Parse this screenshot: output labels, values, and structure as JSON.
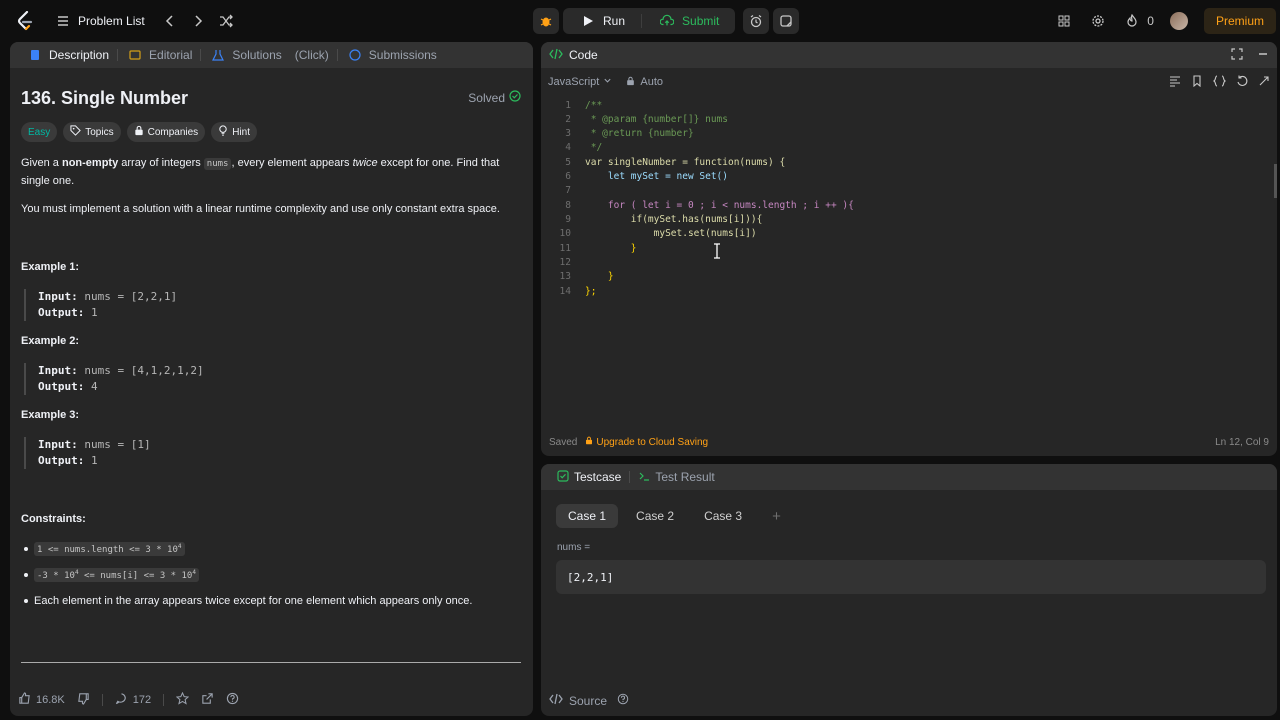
{
  "nav": {
    "problem_list": "Problem List",
    "run": "Run",
    "submit": "Submit",
    "streak": "0",
    "premium": "Premium"
  },
  "left_tabs": {
    "description": "Description",
    "editorial": "Editorial",
    "solutions": "Solutions",
    "click": "(Click)",
    "submissions": "Submissions"
  },
  "problem": {
    "title": "136. Single Number",
    "solved": "Solved",
    "tags": {
      "difficulty": "Easy",
      "topics": "Topics",
      "companies": "Companies",
      "hint": "Hint"
    },
    "para1_a": "Given a ",
    "para1_b": "non-empty",
    "para1_c": " array of integers ",
    "para1_code": "nums",
    "para1_d": ", every element appears ",
    "para1_e": "twice",
    "para1_f": " except for one. Find that single one.",
    "para2": "You must implement a solution with a linear runtime complexity and use only constant extra space.",
    "examples": [
      {
        "title": "Example 1:",
        "input_label": "Input:",
        "input": "nums = [2,2,1]",
        "output_label": "Output:",
        "output": "1"
      },
      {
        "title": "Example 2:",
        "input_label": "Input:",
        "input": "nums = [4,1,2,1,2]",
        "output_label": "Output:",
        "output": "4"
      },
      {
        "title": "Example 3:",
        "input_label": "Input:",
        "input": "nums = [1]",
        "output_label": "Output:",
        "output": "1"
      }
    ],
    "constraints_title": "Constraints:",
    "constraint1": "1 <= nums.length <= 3 * 10",
    "constraint1_sup": "4",
    "constraint2": "-3 * 10",
    "constraint2_sup": "4",
    "constraint2_b": " <= nums[i] <= 3 * 10",
    "constraint2_sup2": "4",
    "constraint3": "Each element in the array appears twice except for one element which appears only once."
  },
  "footer": {
    "likes": "16.8K",
    "comments": "172"
  },
  "code": {
    "header": "Code",
    "language": "JavaScript",
    "mode": "Auto",
    "lines": [
      "/**",
      " * @param {number[]} nums",
      " * @return {number}",
      " */",
      "var singleNumber = function(nums) {",
      "    let mySet = new Set()",
      "",
      "    for ( let i = 0 ; i < nums.length ; i ++ ){",
      "        if(mySet.has(nums[i])){",
      "            mySet.set(nums[i])",
      "        }",
      "",
      "    }",
      "};"
    ],
    "status_saved": "Saved",
    "status_upgrade": "Upgrade to Cloud Saving",
    "cursor_pos": "Ln 12, Col 9"
  },
  "test": {
    "tab_testcase": "Testcase",
    "tab_result": "Test Result",
    "cases": [
      "Case 1",
      "Case 2",
      "Case 3"
    ],
    "add": "+",
    "var_label": "nums =",
    "value": "[2,2,1]",
    "source": "Source"
  },
  "colors": {
    "accent": "#ffa116",
    "easy": "#00b8a3",
    "submit": "#2cbb5d"
  }
}
